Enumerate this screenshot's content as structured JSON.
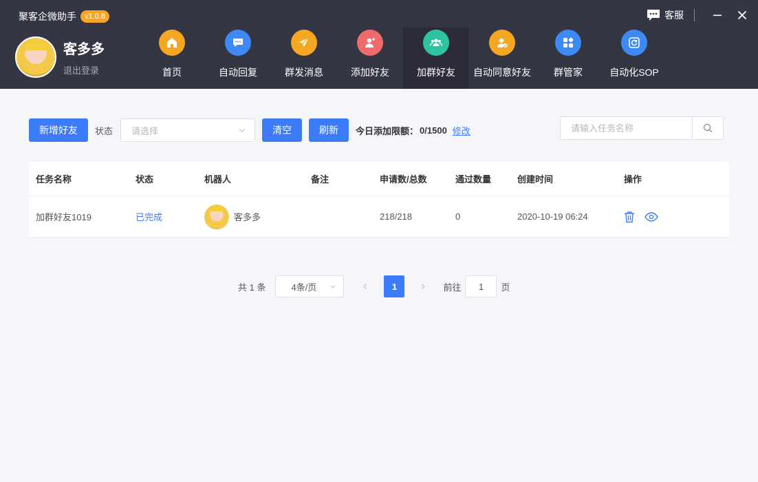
{
  "app": {
    "title": "聚客企微助手",
    "version": "v1.0.8"
  },
  "window": {
    "service_label": "客服"
  },
  "user": {
    "name": "客多多",
    "logout_label": "退出登录"
  },
  "nav": {
    "items": [
      {
        "label": "首页",
        "color": "#f5a623",
        "icon": "home-icon"
      },
      {
        "label": "自动回复",
        "color": "#3d8af7",
        "icon": "chat-bubble-icon"
      },
      {
        "label": "群发消息",
        "color": "#f5a623",
        "icon": "paper-plane-icon"
      },
      {
        "label": "添加好友",
        "color": "#ef6b6b",
        "icon": "add-user-icon"
      },
      {
        "label": "加群好友",
        "color": "#2ec4a1",
        "icon": "group-icon"
      },
      {
        "label": "自动同意好友",
        "color": "#f5a623",
        "icon": "user-check-icon"
      },
      {
        "label": "群管家",
        "color": "#3d8af7",
        "icon": "apps-icon"
      },
      {
        "label": "自动化SOP",
        "color": "#3d8af7",
        "icon": "refresh-icon"
      }
    ],
    "active_index": 4
  },
  "toolbar": {
    "add_button": "新增好友",
    "status_label": "状态",
    "status_placeholder": "请选择",
    "clear_button": "清空",
    "refresh_button": "刷新",
    "quota_label": "今日添加限额：",
    "quota_value": "0/1500",
    "modify_link": "修改"
  },
  "search": {
    "placeholder": "请输入任务名称"
  },
  "table": {
    "headers": [
      "任务名称",
      "状态",
      "机器人",
      "备注",
      "申请数/总数",
      "通过数量",
      "创建时间",
      "操作"
    ],
    "rows": [
      {
        "task_name": "加群好友1019",
        "status": "已完成",
        "robot": "客多多",
        "note": "",
        "requests": "218/218",
        "passed": "0",
        "created": "2020-10-19 06:24"
      }
    ]
  },
  "pagination": {
    "total": "共 1 条",
    "page_size": "4条/页",
    "current_page": "1",
    "goto_label": "前往",
    "goto_value": "1",
    "page_suffix": "页"
  }
}
